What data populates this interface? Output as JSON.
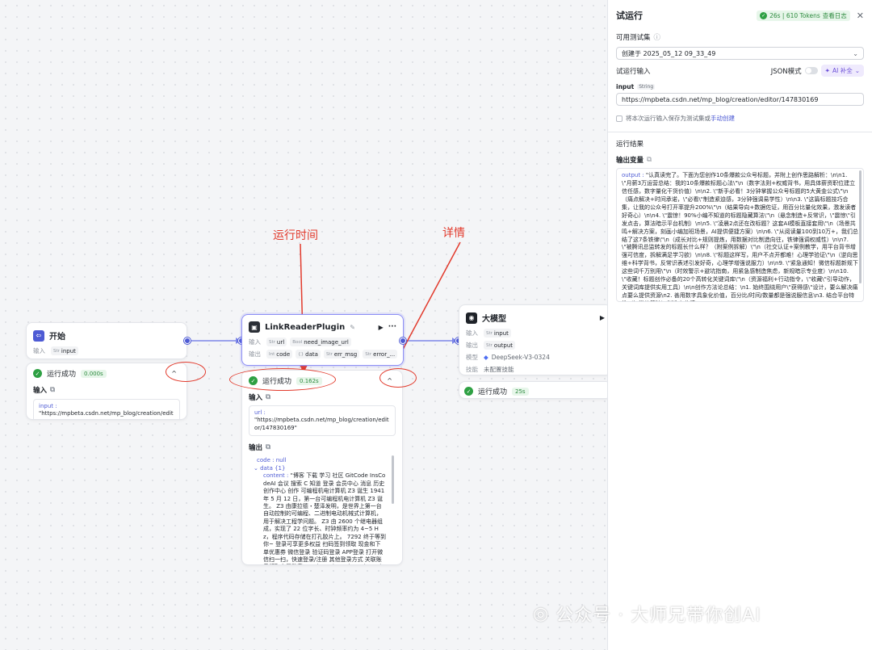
{
  "annotations": {
    "run_time": "运行时间",
    "details": "详情"
  },
  "start_node": {
    "title": "开始",
    "input_label": "输入",
    "input_var": "input",
    "result": {
      "status": "运行成功",
      "time": "0.000s",
      "section_label": "输入",
      "content_key": "input :",
      "content_value": "\"https://mpbeta.csdn.net/mp_blog/creation/editor/147830169\""
    }
  },
  "plugin_node": {
    "title": "LinkReaderPlugin",
    "input_label": "输入",
    "output_label": "输出",
    "inputs": [
      {
        "type": "Str",
        "name": "url"
      },
      {
        "type": "Bool",
        "name": "need_image_url"
      }
    ],
    "outputs": [
      {
        "type": "Int",
        "name": "code"
      },
      {
        "type": "{}",
        "name": "data"
      },
      {
        "type": "Str",
        "name": "err_msg"
      },
      {
        "type": "Str",
        "name": "error_..."
      }
    ],
    "result": {
      "status": "运行成功",
      "time": "0.162s",
      "input_label": "输入",
      "input_key": "url :",
      "input_value": "\"https://mpbeta.csdn.net/mp_blog/creation/editor/147830169\"",
      "output_label": "输出",
      "code_line": "code : null",
      "data_line": "data {1}",
      "content_key": "content :",
      "content_value": "\"博客 下载 学习 社区 GitCode InsCodeAI 会议 搜索 C 知道 登录 会员中心 消息 历史 创作中心 创作 可编程机电计算机 Z3 诞生 1941 年 5 月 12 日，第一台可编程机电计算机 Z3 诞生。 Z3 由康拉德・楚泽发明，是世界上第一台自动控制的可编程、二进制电动机械式计算机，用于解决工程学问题。 Z3 由 2600 个继电器组成，实现了 22 位字长、时钟频率约为 4~5 Hz，程序代码存储在打孔胶片上。 7292 终于等到你~ 登录可享更多权益 扫码签到领取 现金和下单优惠券 微信登录 验证码登录 APP登录 打开微信扫一扫，快速登录/注册 其他登录方式 关联账号领取专属勋章 word word word word word word word word word word word word word word word word word word word word word word word word word word word word word word word word word word word word word word"
    }
  },
  "llm_node": {
    "title": "大模型",
    "input_label": "输入",
    "output_label": "输出",
    "model_label": "模型",
    "skill_label": "技能",
    "input_var": "input",
    "output_var": "output",
    "model_name": "DeepSeek-V3-0324",
    "skill_value": "未配置技能",
    "result": {
      "status": "运行成功",
      "time": "25s"
    }
  },
  "panel": {
    "title": "试运行",
    "stats": "26s | 610 Tokens",
    "view_log": "查看日志",
    "testset_label": "可用测试集",
    "testset_value": "创建于 2025_05_12 09_33_49",
    "trial_input_label": "试运行输入",
    "json_mode": "JSON模式",
    "ai_fill": "AI 补全",
    "input_name": "input",
    "input_type": "String",
    "input_value": "https://mpbeta.csdn.net/mp_blog/creation/editor/147830169",
    "save_text": "将本次运行输入保存为测试集或",
    "manual_create": "手动创建",
    "result_label": "运行结果",
    "output_var_label": "输出变量",
    "output_key": "output :",
    "output_value": "\"认真读完了。下面为您创作10条爆款公众号标题，并附上创作思路解析：\\n\\n1. \\\"月薪3万运营总结：我的10条爆款标题心法\\\"\\n（数字法则+权威背书，用具体薪资职位建立信任感，数字量化干货价值）\\n\\n2. \\\"新手必看！3分钟掌握公众号标题的5大黄金公式\\\"\\n（痛点解决+时间承诺，\\\"必看\\\"制造紧迫感，3分钟强调易学性）\\n\\n3. \\\"这篇标题技巧合集，让我的公众号打开率提升200%\\\"\\n（结果导向+数据佐证，用百分比量化效果，激发读者好奇心）\\n\\n4. \\\"震惊！90%小编不知道的标题隐藏算法\\\"\\n（悬念制造+反常识，\\\"震惊\\\"引发点击，算法暗示平台机制）\\n\\n5. \\\"凌晨2点还在改标题？这套AI模板直接套用\\\"\\n（场景共鸣+解决方案，刻画小编加班场景，AI提供便捷方案）\\n\\n6. \\\"从阅读量100到10万+，我们总结了这7条铁律\\\"\\n（成长对比+规则提炼，用数据对比制造向往，铁律强调权威性）\\n\\n7. \\\"被腾讯总监转发的标题长什么样？（附案例拆解）\\\"\\n（社交认证+案例教学，用平台背书增强可信度，拆解满足学习欲）\\n\\n8. \\\"标题这样写，用户不点开都难！心理学验证\\\"\\n（逆向思维+科学背书，反常识表述引发好奇，心理学增强说服力）\\n\\n9. \\\"紧急通知！微信标题新规下这些词千万别用\\\"\\n（时效警示+避坑指南，用紧急感制造焦虑，新规暗示专业度）\\n\\n10. \\\"收藏！标题创作必备的20个高转化关键词库\\\"\\n（资源福利+行动指令，\\\"收藏\\\"引导动作，关键词库提供实用工具）\\n\\n创作方法论总结：\\n1. 始终围绕用户\\\"获得感\\\"设计，要么解决痛点要么提供资源\\n2. 善用数字具象化价值，百分比/时间/数量都是强说服信息\\n3. 结合平台特性（如微信算法）制造专业感\""
  },
  "watermark": {
    "text": "公众号 · 大师兄带你创AI"
  }
}
